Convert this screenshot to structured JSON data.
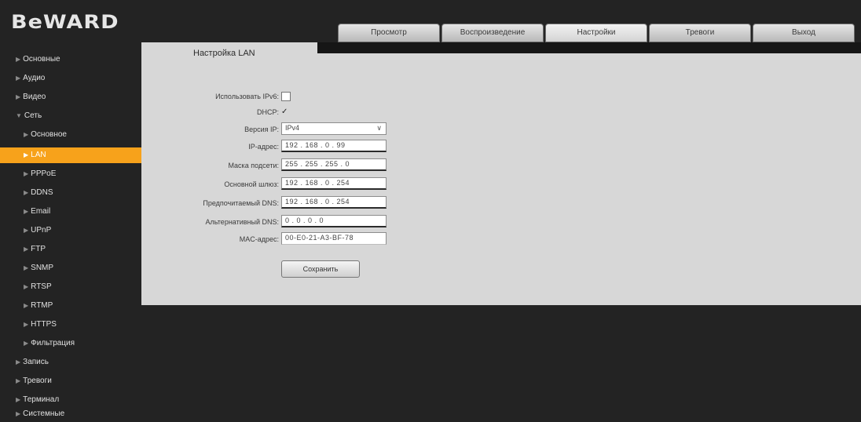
{
  "brand": "BeWARD",
  "tabs": [
    "Просмотр",
    "Воспроизведение",
    "Настройки",
    "Тревоги",
    "Выход"
  ],
  "sidebar": [
    {
      "label": "Основные",
      "level": 0
    },
    {
      "label": "Аудио",
      "level": 0
    },
    {
      "label": "Видео",
      "level": 0
    },
    {
      "label": "Сеть",
      "level": 0,
      "expanded": true
    },
    {
      "label": "Основное",
      "level": 1
    },
    {
      "label": "LAN",
      "level": 1,
      "active": true
    },
    {
      "label": "PPPoE",
      "level": 1
    },
    {
      "label": "DDNS",
      "level": 1
    },
    {
      "label": "Email",
      "level": 1
    },
    {
      "label": "UPnP",
      "level": 1
    },
    {
      "label": "FTP",
      "level": 1
    },
    {
      "label": "SNMP",
      "level": 1
    },
    {
      "label": "RTSP",
      "level": 1
    },
    {
      "label": "RTMP",
      "level": 1
    },
    {
      "label": "HTTPS",
      "level": 1
    },
    {
      "label": "Фильтрация",
      "level": 1
    },
    {
      "label": "Запись",
      "level": 0
    },
    {
      "label": "Тревоги",
      "level": 0
    },
    {
      "label": "Терминал",
      "level": 0
    },
    {
      "label": "Системные",
      "level": 0
    }
  ],
  "panel": {
    "title": "Настройка LAN",
    "fields": {
      "ipv6": {
        "label": "Использовать IPv6:",
        "checked": false
      },
      "dhcp": {
        "label": "DHCP:",
        "checked": true,
        "mark": "✓"
      },
      "ip_version": {
        "label": "Версия IP:",
        "value": "IPv4"
      },
      "ip": {
        "label": "IP-адрес:",
        "value": "192 . 168 . 0 . 99"
      },
      "mask": {
        "label": "Маска подсети:",
        "value": "255 . 255 . 255 . 0"
      },
      "gateway": {
        "label": "Основной шлюз:",
        "value": "192 . 168 . 0 . 254"
      },
      "dns1": {
        "label": "Предпочитаемый DNS:",
        "value": "192 . 168 . 0 . 254"
      },
      "dns2": {
        "label": "Альтернативный DNS:",
        "value": "0 . 0 . 0 . 0"
      },
      "mac": {
        "label": "MAC-адрес:",
        "value": "00-E0-21-A3-BF-78"
      }
    },
    "save_label": "Сохранить"
  },
  "colors": {
    "accent": "#f7a21b",
    "panel_bg": "#d7d7d7",
    "page_bg": "#232323"
  }
}
